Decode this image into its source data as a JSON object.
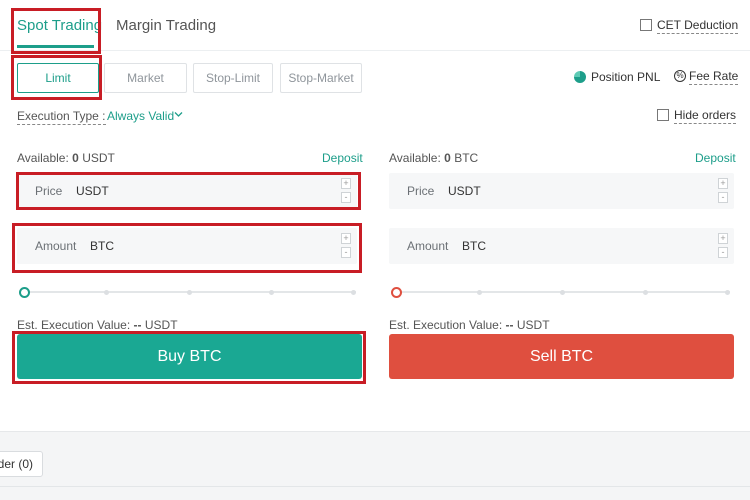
{
  "header": {
    "tabs": [
      {
        "label": "Spot Trading",
        "active": true
      },
      {
        "label": "Margin Trading",
        "active": false
      }
    ],
    "cet_deduction_label": "CET Deduction"
  },
  "order_types": [
    {
      "label": "Limit",
      "active": true
    },
    {
      "label": "Market",
      "active": false
    },
    {
      "label": "Stop-Limit",
      "active": false
    },
    {
      "label": "Stop-Market",
      "active": false
    }
  ],
  "links": {
    "position_pnl": "Position PNL",
    "fee_rate": "Fee Rate",
    "hide_orders": "Hide orders"
  },
  "execution": {
    "label": "Execution Type :",
    "value": "Always Valid"
  },
  "buy": {
    "available_label": "Available:",
    "available_value": "0",
    "available_unit": "USDT",
    "deposit": "Deposit",
    "price_label": "Price",
    "price_unit": "USDT",
    "amount_label": "Amount",
    "amount_unit": "BTC",
    "est_label": "Est. Execution Value:",
    "est_value": "--",
    "est_unit": "USDT",
    "button": "Buy BTC",
    "slider_percent": 0
  },
  "sell": {
    "available_label": "Available:",
    "available_value": "0",
    "available_unit": "BTC",
    "deposit": "Deposit",
    "price_label": "Price",
    "price_unit": "USDT",
    "amount_label": "Amount",
    "amount_unit": "BTC",
    "est_label": "Est. Execution Value:",
    "est_value": "--",
    "est_unit": "USDT",
    "button": "Sell BTC",
    "slider_percent": 0
  },
  "stepper": {
    "plus": "+",
    "minus": "-"
  },
  "bottom": {
    "order_tab": "der (0)"
  },
  "colors": {
    "accent": "#1d9e8a",
    "buy": "#1aa893",
    "sell": "#df4f3f",
    "highlight": "#c81d25"
  },
  "icons": {
    "pnl": "pie-chart-icon",
    "fee": "fee-rate-icon",
    "execution_dropdown": "chevron-down-icon"
  }
}
